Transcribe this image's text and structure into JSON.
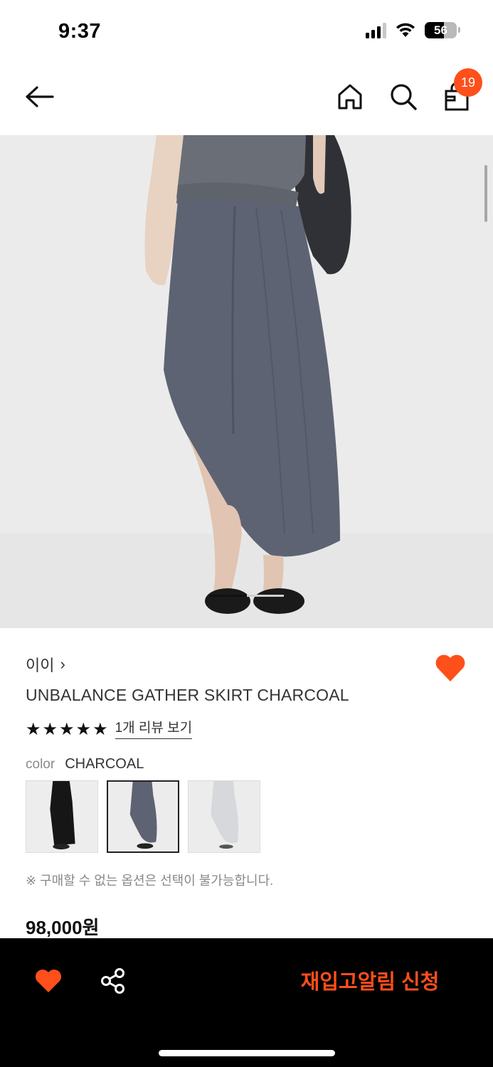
{
  "status_bar": {
    "time": "9:37",
    "battery": "56"
  },
  "header": {
    "back_icon": "arrow-left-icon",
    "home_icon": "home-icon",
    "search_icon": "search-icon",
    "cart_icon": "shopping-bag-icon",
    "cart_count": "19"
  },
  "product": {
    "brand": "이이",
    "brand_chevron": "›",
    "name": "UNBALANCE GATHER SKIRT CHARCOAL",
    "rating_stars": 5,
    "review_link": "1개 리뷰 보기",
    "color_label": "color",
    "color_value": "CHARCOAL",
    "swatches": [
      {
        "name": "black",
        "selected": false
      },
      {
        "name": "charcoal",
        "selected": true
      },
      {
        "name": "light-gray",
        "selected": false
      }
    ],
    "option_note": "※ 구매할 수 없는 옵션은 선택이 불가능합니다.",
    "price": "98,000원"
  },
  "bottom_bar": {
    "restock_label": "재입고알림 신청",
    "heart_icon": "heart-icon",
    "share_icon": "share-icon"
  },
  "colors": {
    "accent": "#ff4f1a",
    "bottom_bar_bg": "#000000",
    "text": "#333333",
    "muted": "#888888"
  }
}
